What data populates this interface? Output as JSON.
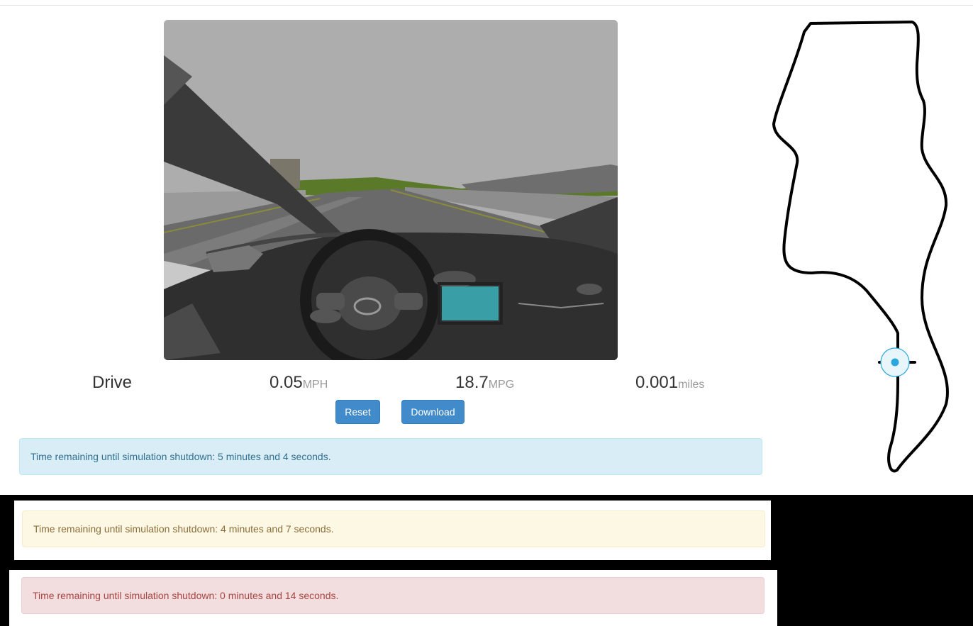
{
  "status": {
    "mode": "Drive",
    "speed": {
      "value": "0.05",
      "unit": "MPH"
    },
    "efficiency": {
      "value": "18.7",
      "unit": "MPG"
    },
    "distance": {
      "value": "0.001",
      "unit": "miles"
    }
  },
  "controls": {
    "reset_label": "Reset",
    "download_label": "Download"
  },
  "alerts": [
    {
      "type": "info",
      "text": "Time remaining until simulation shutdown: 5 minutes and 4 seconds."
    },
    {
      "type": "warning",
      "text": "Time remaining until simulation shutdown: 4 minutes and 7 seconds."
    },
    {
      "type": "danger",
      "text": "Time remaining until simulation shutdown: 0 minutes and 14 seconds."
    }
  ],
  "colors": {
    "primary_button": "#428bca",
    "info": "#31708f",
    "warning": "#8a6d3b",
    "danger": "#a94442",
    "position_marker": "#2aa7dc"
  },
  "map": {
    "marker_icon": "current-position-icon"
  }
}
